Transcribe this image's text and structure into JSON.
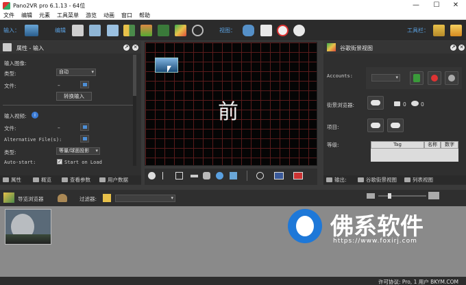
{
  "window": {
    "title": "Pano2VR pro 6.1.13 - 64位",
    "minimize": "—",
    "maximize": "☐",
    "close": "✕"
  },
  "menu": [
    "文件",
    "编辑",
    "元素",
    "工具菜单",
    "游览",
    "动画",
    "窗口",
    "帮助"
  ],
  "toolbar": {
    "input_label": "输入：",
    "edit_label": "编辑",
    "view_label": "视图：",
    "tools_label": "工具栏："
  },
  "properties": {
    "title": "属性 - 输入",
    "input_image_section": "输入图像:",
    "type_label": "类型:",
    "type_value": "自动",
    "file_label": "文件:",
    "file_value": "–",
    "convert_button": "转换输入",
    "input_video_section": "输入视频:",
    "video_file_label": "文件:",
    "video_file_value": "–",
    "alt_files_label": "Alternative File(s):",
    "video_type_label": "类型:",
    "video_type_value": "等量/球面投影",
    "autostart_label": "Auto-start:",
    "autostart_value": "Start on Load",
    "tabs": [
      "属性",
      "概览",
      "查看参数",
      "用户数据"
    ]
  },
  "viewer": {
    "glyph": "前"
  },
  "streetview": {
    "title": "谷歌街景视图",
    "accounts_label": "Accounts:",
    "browser_label": "街景浏览器:",
    "photo_count": "0",
    "view_count": "0",
    "project_label": "项目:",
    "level_label": "等级:",
    "columns": [
      "Tag",
      "名称",
      "数字"
    ],
    "tabs": [
      "输出:",
      "谷歌街景视图",
      "列表视图"
    ]
  },
  "tour_browser": {
    "title": "导览浏览器",
    "filter_label": "过滤器:",
    "filter_value": ""
  },
  "watermark": {
    "name": "佛系软件",
    "url": "https://www.foxirj.com"
  },
  "status": {
    "text": "许可协议: Pro, 1 用户 BKYM.COM"
  }
}
